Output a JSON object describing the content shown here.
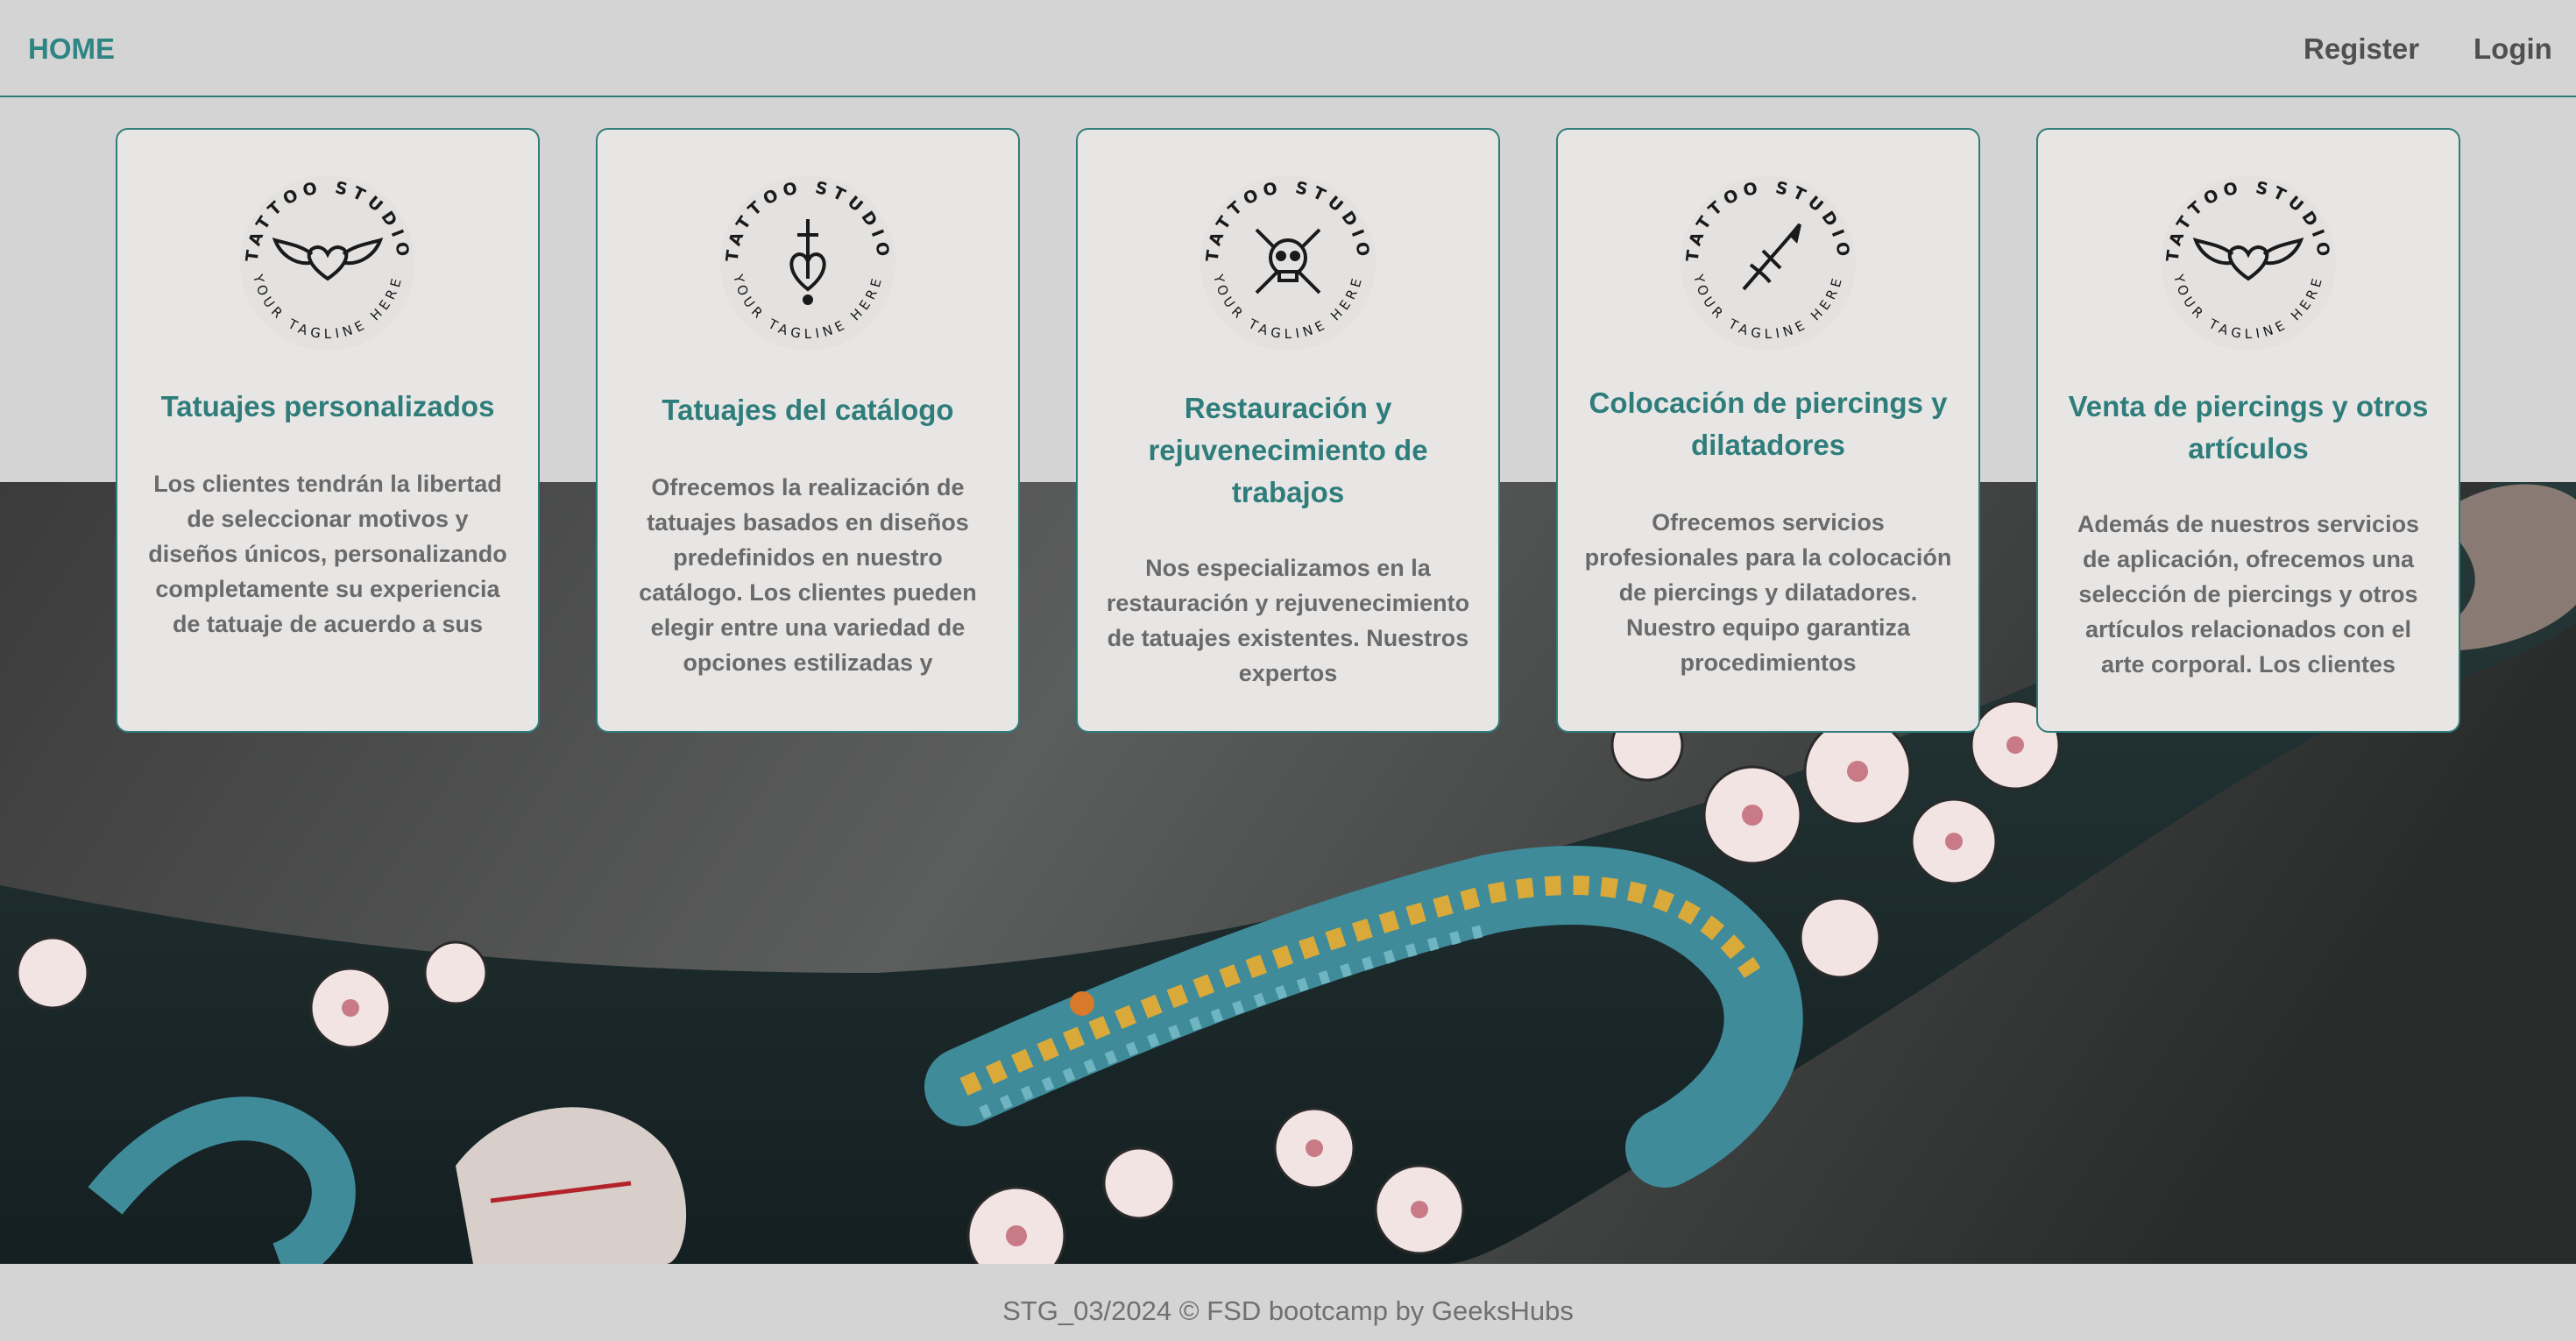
{
  "nav": {
    "home_label": "HOME",
    "register_label": "Register",
    "login_label": "Login"
  },
  "colors": {
    "accent": "#2f7d7b",
    "background": "#d4d4d4",
    "card_background": "#e8e6e5",
    "body_text": "#6a6a6a"
  },
  "logo": {
    "top_text": "TATTOO STUDIO",
    "bottom_text": "YOUR TAGLINE HERE"
  },
  "cards": [
    {
      "icon": "winged-heart-icon",
      "title": "Tatuajes personalizados",
      "text": "Los clientes tendrán la libertad de seleccionar motivos y diseños únicos, personalizando completamente su experiencia de tatuaje de acuerdo a sus preferencias y gustos."
    },
    {
      "icon": "heart-dagger-icon",
      "title": "Tatuajes del catálogo",
      "text": "Ofrecemos la realización de tatuajes basados en diseños predefinidos en nuestro catálogo. Los clientes pueden elegir entre una variedad de opciones estilizadas y"
    },
    {
      "icon": "skull-crossed-swords-icon",
      "title": "Restauración y rejuvenecimiento de trabajos",
      "text": "Nos especializamos en la restauración y rejuvenecimiento de tatuajes existentes. Nuestros expertos"
    },
    {
      "icon": "dagger-icon",
      "title": "Colocación de piercings y dilatadores",
      "text": "Ofrecemos servicios profesionales para la colocación de piercings y dilatadores. Nuestro equipo garantiza procedimientos"
    },
    {
      "icon": "winged-heart-icon",
      "title": "Venta de piercings y otros artículos",
      "text": "Además de nuestros servicios de aplicación, ofrecemos una selección de piercings y otros artículos relacionados con el arte corporal. Los clientes"
    }
  ],
  "footer": {
    "text": "STG_03/2024 © FSD bootcamp by GeeksHubs"
  }
}
